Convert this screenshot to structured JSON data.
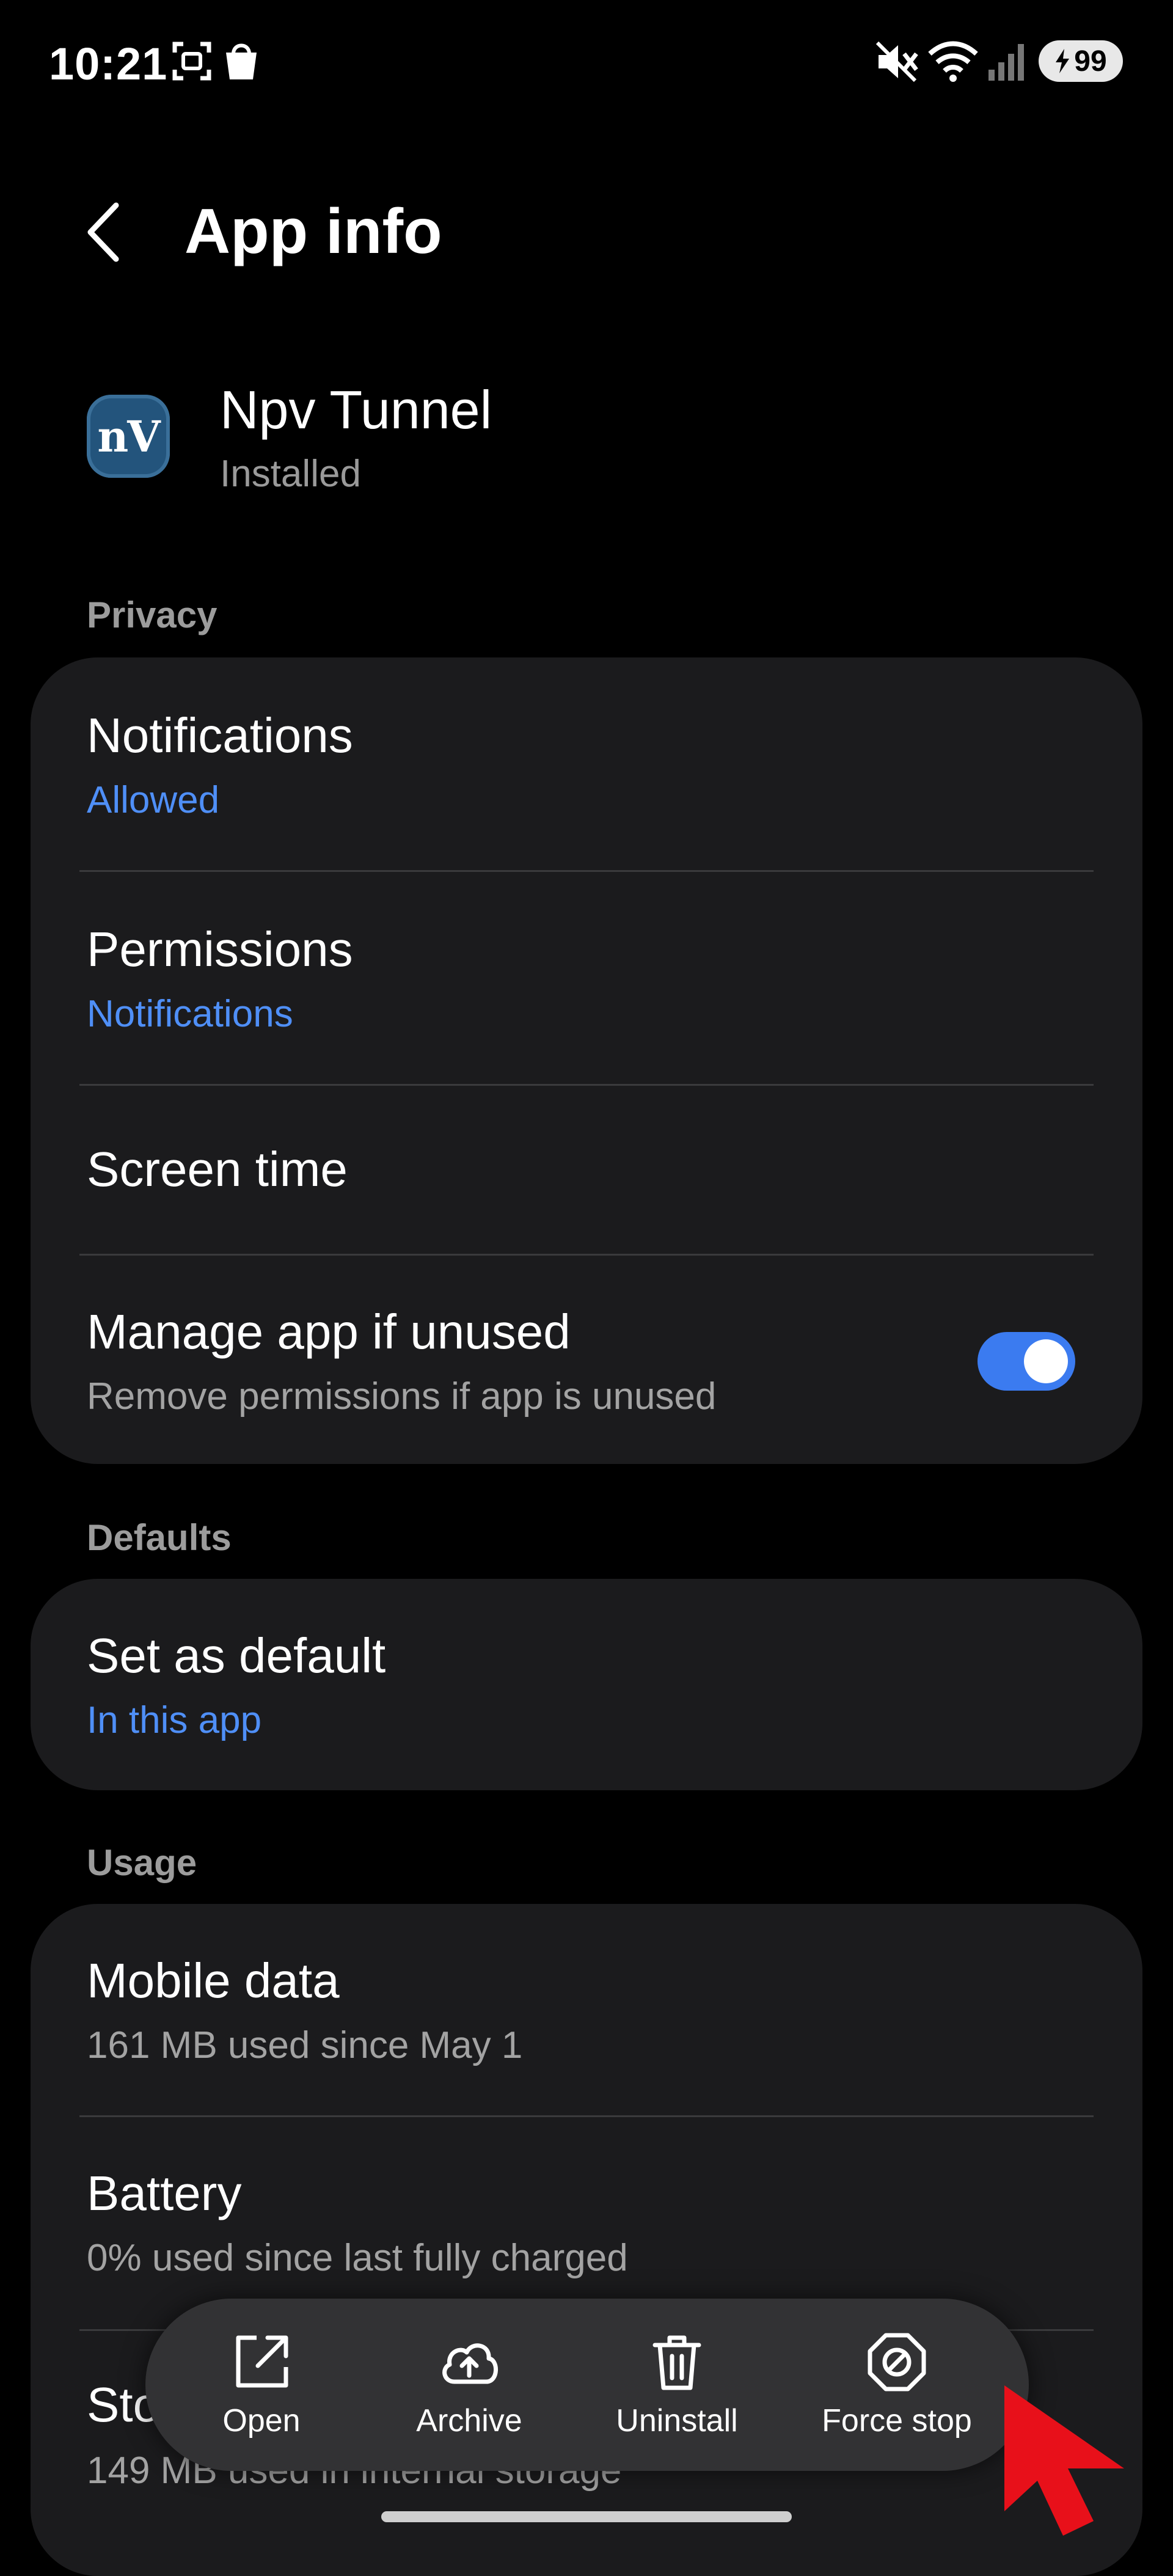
{
  "status_bar": {
    "time": "10:21",
    "battery": "99"
  },
  "header": {
    "title": "App info"
  },
  "app": {
    "name": "Npv Tunnel",
    "status": "Installed",
    "icon_text": "nV",
    "icon_color": "#23547c"
  },
  "sections": {
    "privacy": "Privacy",
    "defaults": "Defaults",
    "usage": "Usage"
  },
  "privacy": {
    "notifications": {
      "title": "Notifications",
      "subtitle": "Allowed"
    },
    "permissions": {
      "title": "Permissions",
      "subtitle": "Notifications"
    },
    "screen_time": {
      "title": "Screen time"
    },
    "manage_unused": {
      "title": "Manage app if unused",
      "subtitle": "Remove permissions if app is unused",
      "enabled": true
    }
  },
  "defaults": {
    "set_default": {
      "title": "Set as default",
      "subtitle": "In this app"
    }
  },
  "usage": {
    "mobile_data": {
      "title": "Mobile data",
      "subtitle": "161 MB used since May 1"
    },
    "battery": {
      "title": "Battery",
      "subtitle": "0% used since last fully charged"
    },
    "storage": {
      "title": "Storage",
      "subtitle": "149 MB used in internal storage"
    }
  },
  "actions": {
    "open": "Open",
    "archive": "Archive",
    "uninstall": "Uninstall",
    "force_stop": "Force stop"
  },
  "colors": {
    "accent": "#4f8ff7",
    "toggle_on": "#3b7bf0",
    "card": "#1b1b1d",
    "cursor": "#e8101a"
  }
}
